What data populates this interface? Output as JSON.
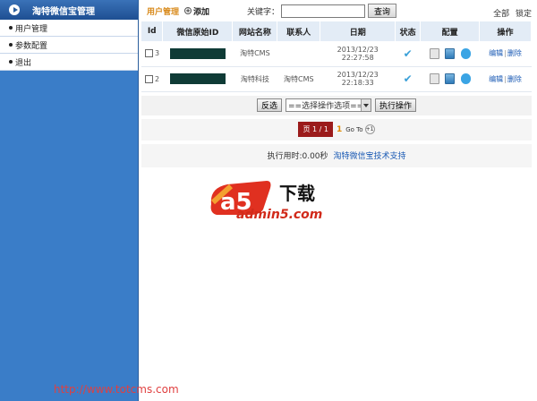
{
  "sidebar": {
    "title": "淘特微信宝管理",
    "items": [
      {
        "label": "用户管理"
      },
      {
        "label": "参数配置"
      },
      {
        "label": "退出"
      }
    ]
  },
  "toolbar": {
    "title": "用户管理",
    "add_label": "添加",
    "keyword_label": "关键字：",
    "keyword_value": "",
    "query_label": "查询",
    "all_label": "全部",
    "lock_label": "锁定"
  },
  "table": {
    "headers": [
      "Id",
      "微信原始ID",
      "网站名称",
      "联系人",
      "日期",
      "状态",
      "配置",
      "操作"
    ],
    "rows": [
      {
        "id": "3",
        "wechat_id": "",
        "site_name": "淘特CMS",
        "contact": "",
        "date": "2013/12/23 22:27:58",
        "status": "✔",
        "edit": "编辑",
        "delete": "删除"
      },
      {
        "id": "2",
        "wechat_id": "",
        "site_name": "淘特科技",
        "contact": "淘特CMS",
        "date": "2013/12/23 22:18:33",
        "status": "✔",
        "edit": "编辑",
        "delete": "删除"
      }
    ]
  },
  "actions": {
    "invert_label": "反选",
    "select_value": "==选择操作选项==",
    "execute_label": "执行操作"
  },
  "pager": {
    "page_label": "页 1 / 1",
    "current": "1",
    "goto_label": "Go To",
    "goto_button": "+1"
  },
  "footer": {
    "exec_time": "执行用时:0.00秒",
    "support": "淘特微信宝技术支持"
  },
  "watermark": {
    "logo_a5": "a5",
    "logo_text": "下载",
    "logo_url": "admin5.com"
  },
  "bottom_url": "http://www.totcms.com",
  "colors": {
    "sidebar": "#3a7dc8",
    "title_accent": "#d98c1f",
    "link": "#1a5ab4",
    "pager_box": "#9b1b1b"
  }
}
